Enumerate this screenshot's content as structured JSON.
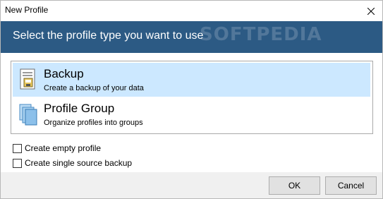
{
  "window": {
    "title": "New Profile"
  },
  "banner": {
    "text": "Select the profile type you want to use",
    "watermark": "SOFTPEDIA"
  },
  "profile_types": [
    {
      "title": "Backup",
      "description": "Create a backup of your data",
      "icon": "backup-document-icon",
      "selected": true
    },
    {
      "title": "Profile Group",
      "description": "Organize profiles into groups",
      "icon": "profile-group-icon",
      "selected": false
    }
  ],
  "options": [
    {
      "label": "Create empty profile",
      "checked": false
    },
    {
      "label": "Create single source backup",
      "checked": false
    }
  ],
  "buttons": {
    "ok": "OK",
    "cancel": "Cancel"
  },
  "colors": {
    "banner": "#2c5a84",
    "selection": "#cce8ff",
    "footer": "#f0f0f0"
  }
}
